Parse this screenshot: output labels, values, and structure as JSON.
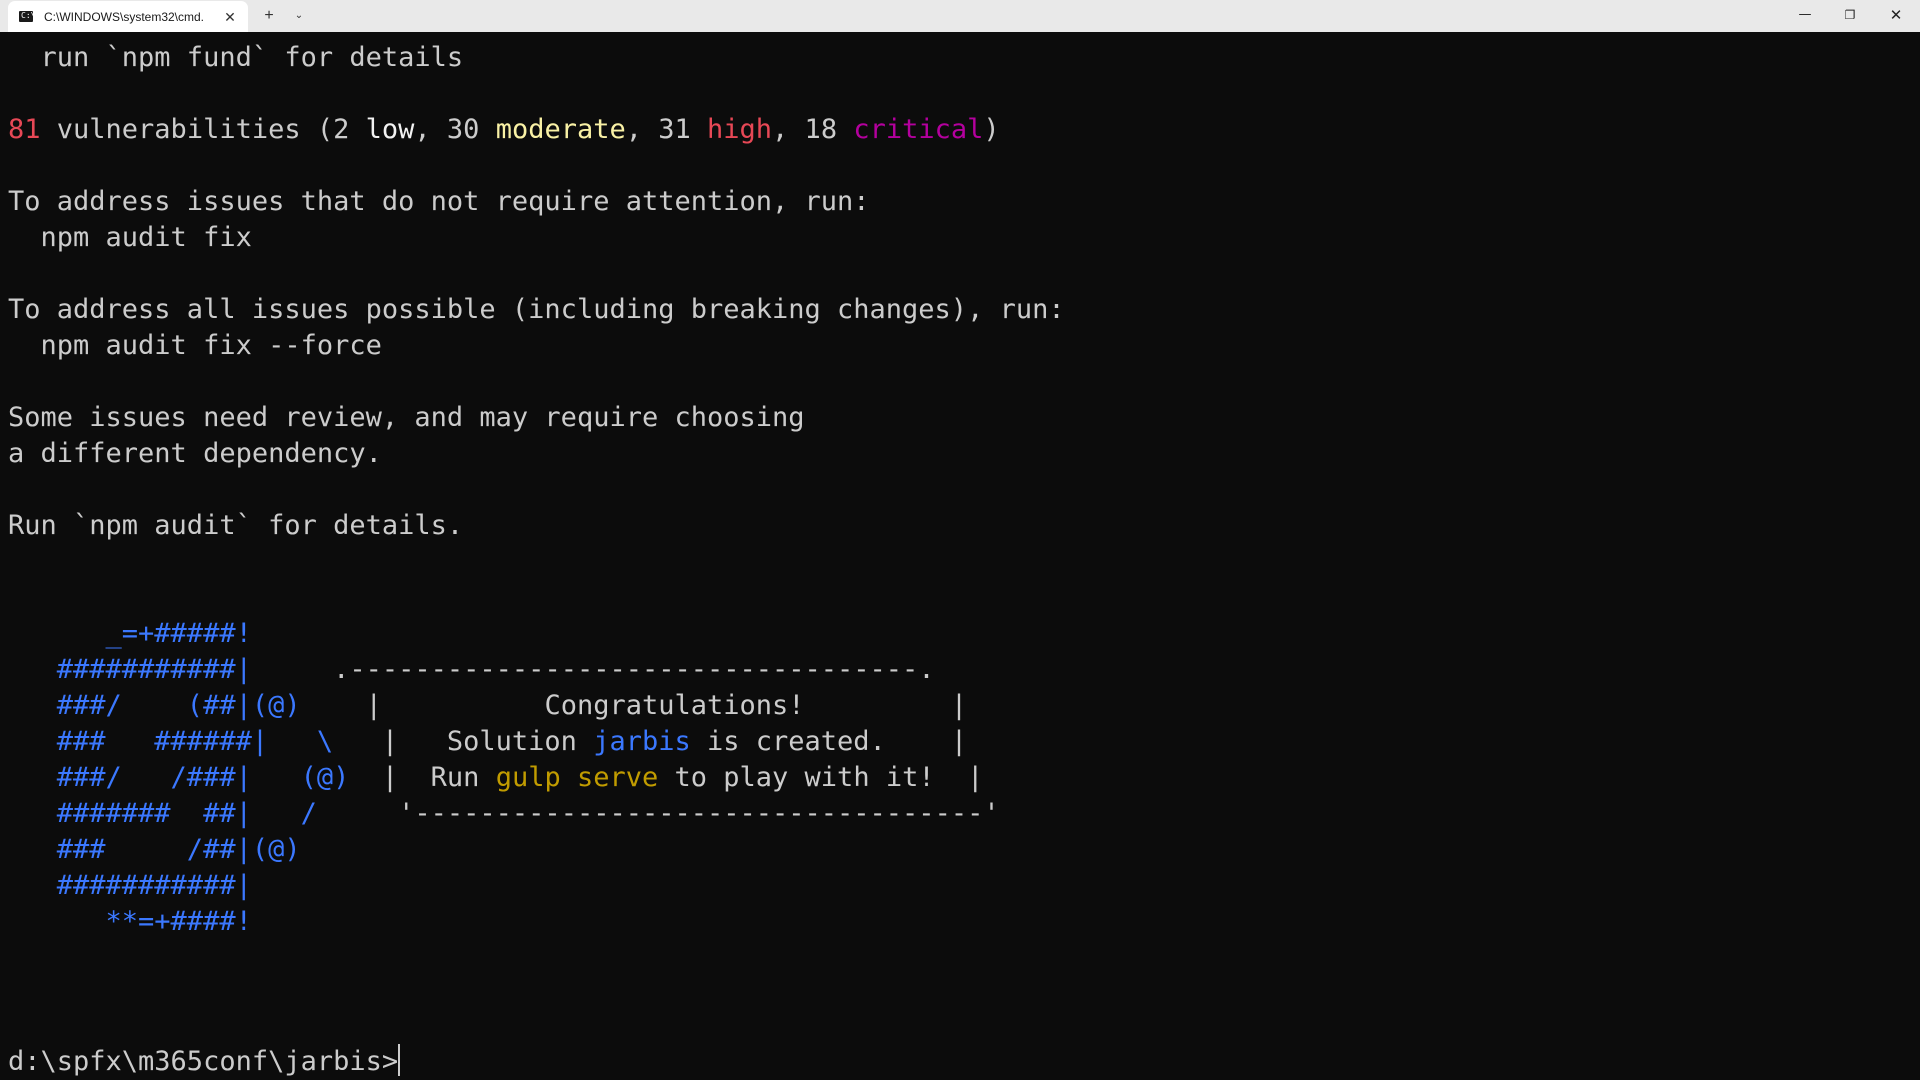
{
  "window": {
    "tab_title": "C:\\WINDOWS\\system32\\cmd.",
    "tab_icon_glyph": "C:\\",
    "tab_close": "✕",
    "new_tab": "+",
    "tab_dropdown": "⌄",
    "minimize": "—",
    "maximize": "❐",
    "close": "✕"
  },
  "terminal": {
    "fund_line": "  run `npm fund` for details",
    "vuln": {
      "total": "81",
      "pre": " vulnerabilities (2 ",
      "low": "low",
      "mid1": ", 30 ",
      "moderate": "moderate",
      "mid2": ", 31 ",
      "high": "high",
      "mid3": ", 18 ",
      "critical": "critical",
      "end": ")"
    },
    "audit_intro": "To address issues that do not require attention, run:",
    "audit_cmd": "  npm audit fix",
    "force_intro": "To address all issues possible (including breaking changes), run:",
    "force_cmd": "  npm audit fix --force",
    "review1": "Some issues need review, and may require choosing",
    "review2": "a different dependency.",
    "run_audit": "Run `npm audit` for details.",
    "art": {
      "a1": "      _=+#####!",
      "a2a": "   ###########|",
      "a2b": "     .-----------------------------------.",
      "a3a": "   ###/    (##|(@)",
      "a3b": "    |          Congratulations!         |",
      "a4a": "   ###   ######|   \\",
      "a4b": "   |   Solution ",
      "a4c": "jarbis",
      "a4d": " is created.    |",
      "a5a": "   ###/   /###|   (@)",
      "a5b": "  |  Run ",
      "a5c": "gulp serve",
      "a5d": " to play with it!  |",
      "a6a": "   #######  ##|   /",
      "a6b": "     '-----------------------------------'",
      "a7a": "   ###     /##|(@)",
      "a8a": "   ###########|",
      "a9a": "      **=+####!"
    },
    "prompt": "d:\\spfx\\m365conf\\jarbis>"
  }
}
